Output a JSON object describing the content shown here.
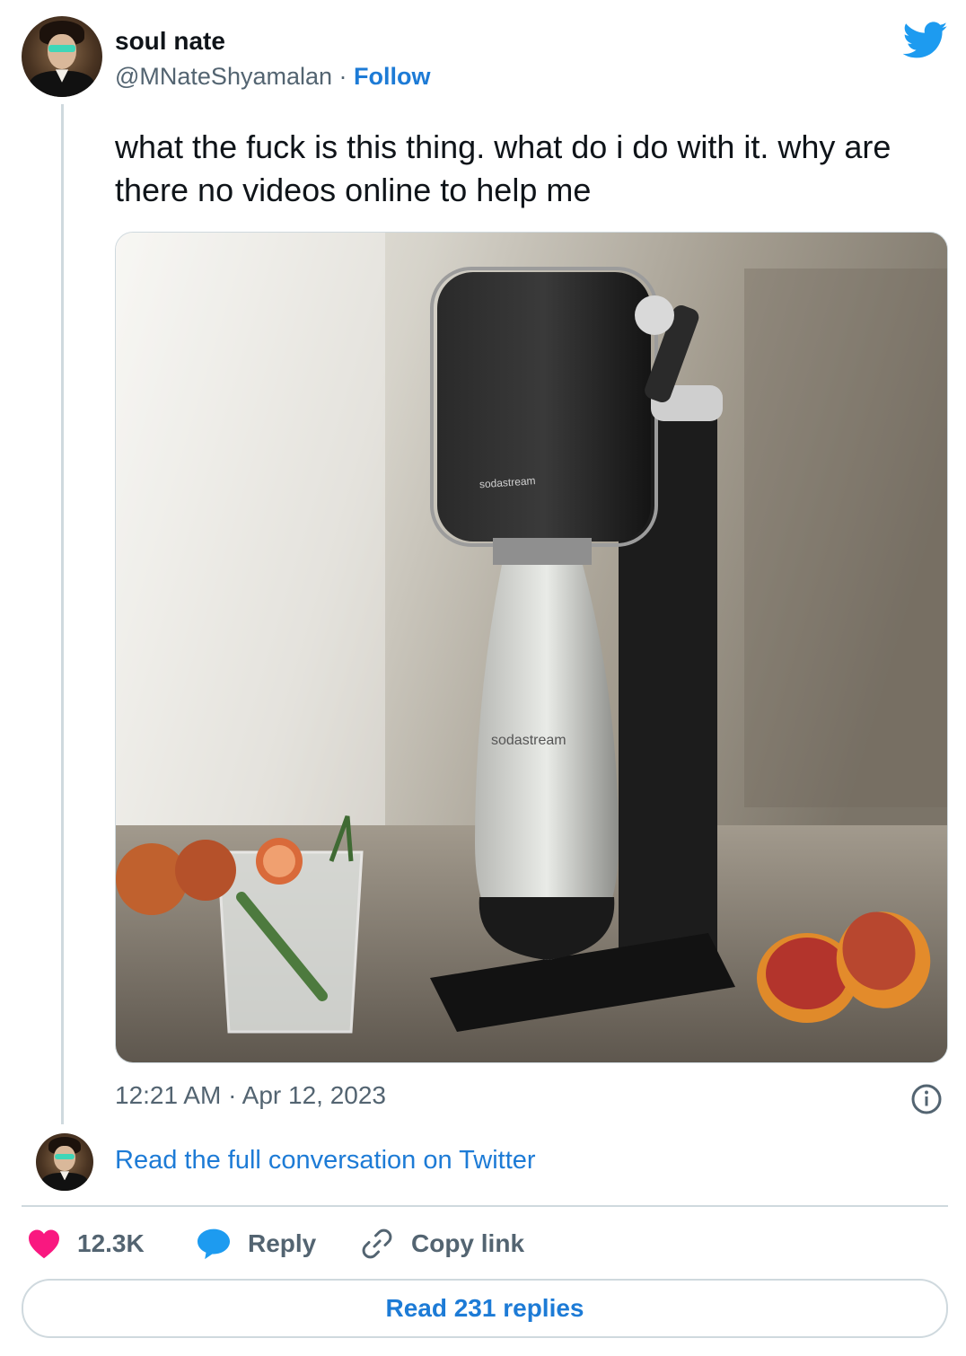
{
  "tweet": {
    "display_name": "soul nate",
    "handle": "@MNateShyamalan",
    "separator": " · ",
    "follow_label": "Follow",
    "text": "what the fuck is this thing. what do i do with it. why are there no videos online to help me",
    "media": {
      "brand_on_machine": "sodastream",
      "brand_on_bottle": "sodastream"
    },
    "timestamp": "12:21 AM · Apr 12, 2023"
  },
  "conversation": {
    "read_full_label": "Read the full conversation on Twitter"
  },
  "actions": {
    "likes": "12.3K",
    "reply_label": "Reply",
    "copy_link_label": "Copy link"
  },
  "footer": {
    "read_replies_label": "Read 231 replies"
  },
  "colors": {
    "accent": "#1d7bd6",
    "twitter_blue": "#1d9bf0",
    "like_pink": "#f91880",
    "muted": "#536471"
  },
  "icons": {
    "brand": "twitter-bird-icon",
    "info": "info-icon",
    "like": "heart-icon",
    "reply": "speech-bubble-icon",
    "copy": "link-icon"
  }
}
